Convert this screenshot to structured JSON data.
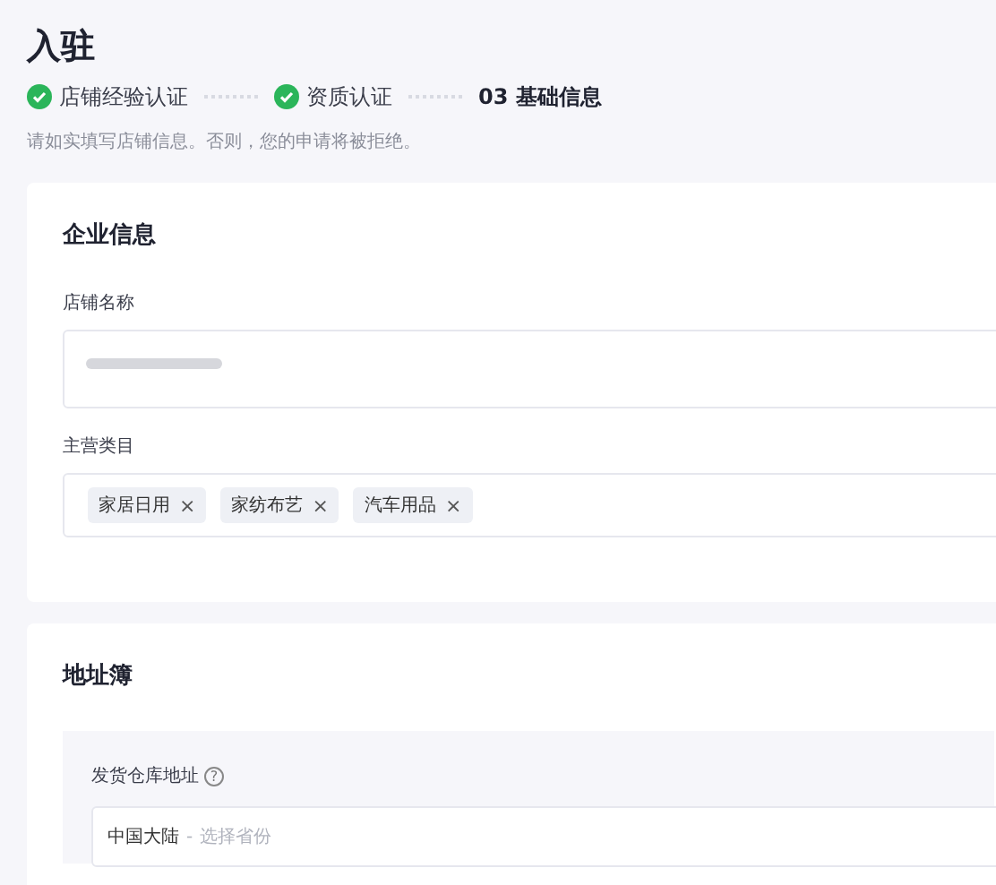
{
  "page": {
    "title": "入驻",
    "hint": "请如实填写店铺信息。否则，您的申请将被拒绝。"
  },
  "steps": [
    {
      "label": "店铺经验认证",
      "done": true
    },
    {
      "label": "资质认证",
      "done": true
    },
    {
      "label": "基础信息",
      "done": false,
      "number": "03"
    }
  ],
  "company_card": {
    "title": "企业信息",
    "shop_name": {
      "label": "店铺名称"
    },
    "category": {
      "label": "主营类目",
      "tags": [
        {
          "label": "家居日用",
          "remove": "×"
        },
        {
          "label": "家纺布艺",
          "remove": "×"
        },
        {
          "label": "汽车用品",
          "remove": "×"
        }
      ]
    }
  },
  "address_card": {
    "title": "地址簿",
    "warehouse": {
      "label": "发货仓库地址",
      "help": "?",
      "region": "中国大陆",
      "separator": "-",
      "placeholder": "选择省份"
    }
  }
}
